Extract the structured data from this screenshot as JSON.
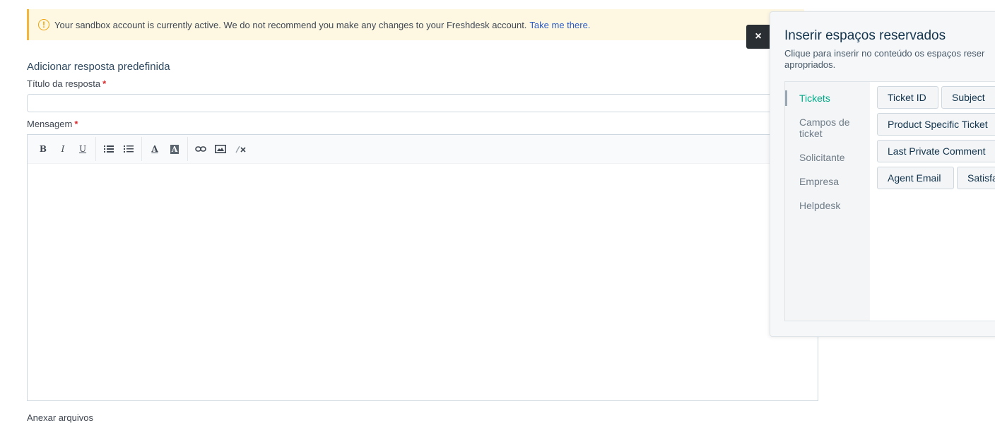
{
  "banner": {
    "message": "Your sandbox account is currently active. We do not recommend you make any changes to your Freshdesk account.",
    "link": "Take me there."
  },
  "form": {
    "title": "Adicionar resposta predefinida",
    "response_title_label": "Título da resposta",
    "message_label": "Mensagem",
    "required_mark": "*",
    "attach_label": "Anexar arquivos"
  },
  "toolbar": {
    "bold": "B",
    "italic": "I",
    "underline": "U",
    "font_color": "A",
    "bg_color": "A"
  },
  "placeholders_panel": {
    "close": "×",
    "title": "Inserir espaços reservados",
    "description": "Clique para inserir no conteúdo os espaços reser\napropriados.",
    "categories": [
      "Tickets",
      "Campos de ticket",
      "Solicitante",
      "Empresa",
      "Helpdesk"
    ],
    "active_category": "Tickets",
    "buttons": [
      "Ticket ID",
      "Subject",
      "Product Specific Ticket",
      "Last Private Comment",
      "Agent Email",
      "Satisfa"
    ]
  },
  "colors": {
    "accent_green": "#00a886",
    "link_blue": "#2c5cc5",
    "banner_bg": "#fef8e3",
    "warning": "#f0a30a",
    "required": "#d72d30"
  }
}
